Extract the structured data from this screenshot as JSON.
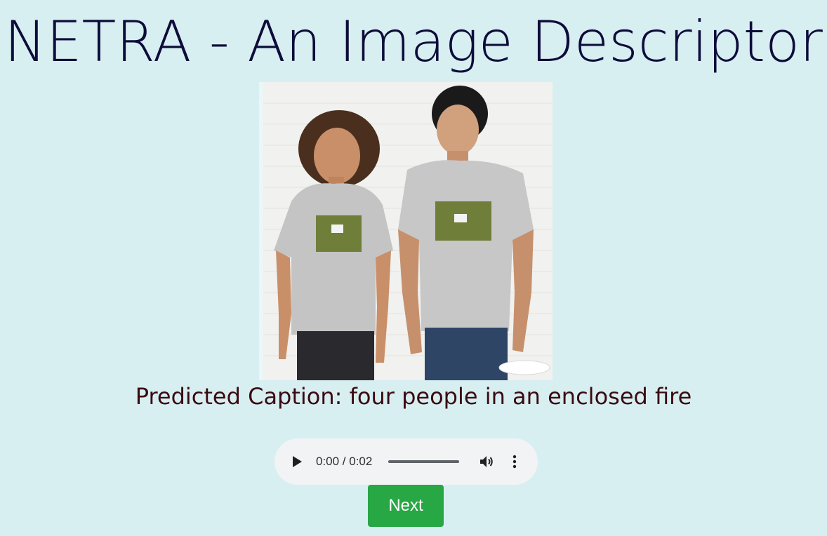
{
  "page": {
    "title": "NETRA - An Image Descriptor",
    "caption": "Predicted Caption: four people in an enclosed fire"
  },
  "audio": {
    "time_display": "0:00 / 0:02"
  },
  "actions": {
    "next_label": "Next"
  },
  "icons": {
    "play": "play-icon",
    "volume": "volume-icon",
    "more": "more-vert-icon"
  },
  "colors": {
    "background": "#d8eff2",
    "title": "#0d0c3a",
    "caption": "#3a0b10",
    "button": "#28a745"
  }
}
